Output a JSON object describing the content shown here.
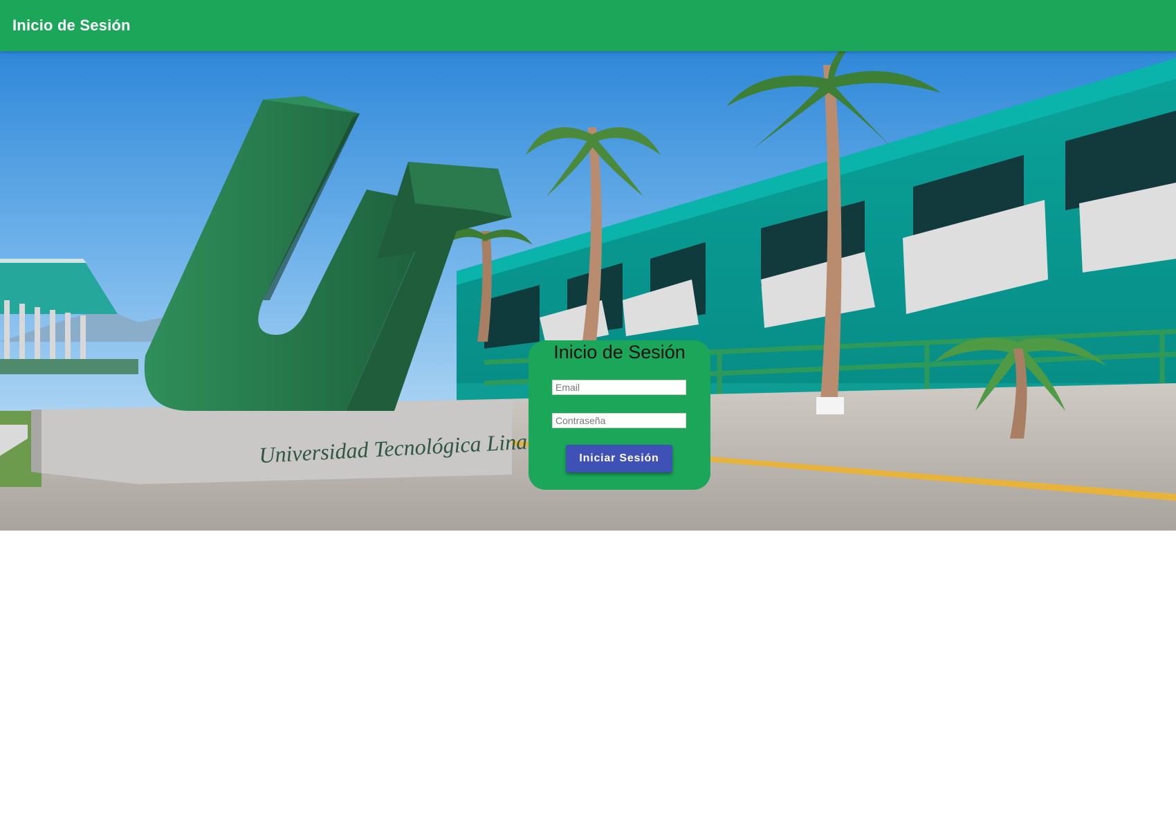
{
  "header": {
    "title": "Inicio de Sesión",
    "color": "#1ba659"
  },
  "hero": {
    "description_icon": "campus-photo",
    "sign_text": "Universidad Tecnológica Linares"
  },
  "login": {
    "title": "Inicio de Sesión",
    "email_placeholder": "Email",
    "password_placeholder": "Contraseña",
    "submit_label": "Iniciar Sesión",
    "card_color": "#1ba659",
    "button_color": "#3f51b5"
  }
}
